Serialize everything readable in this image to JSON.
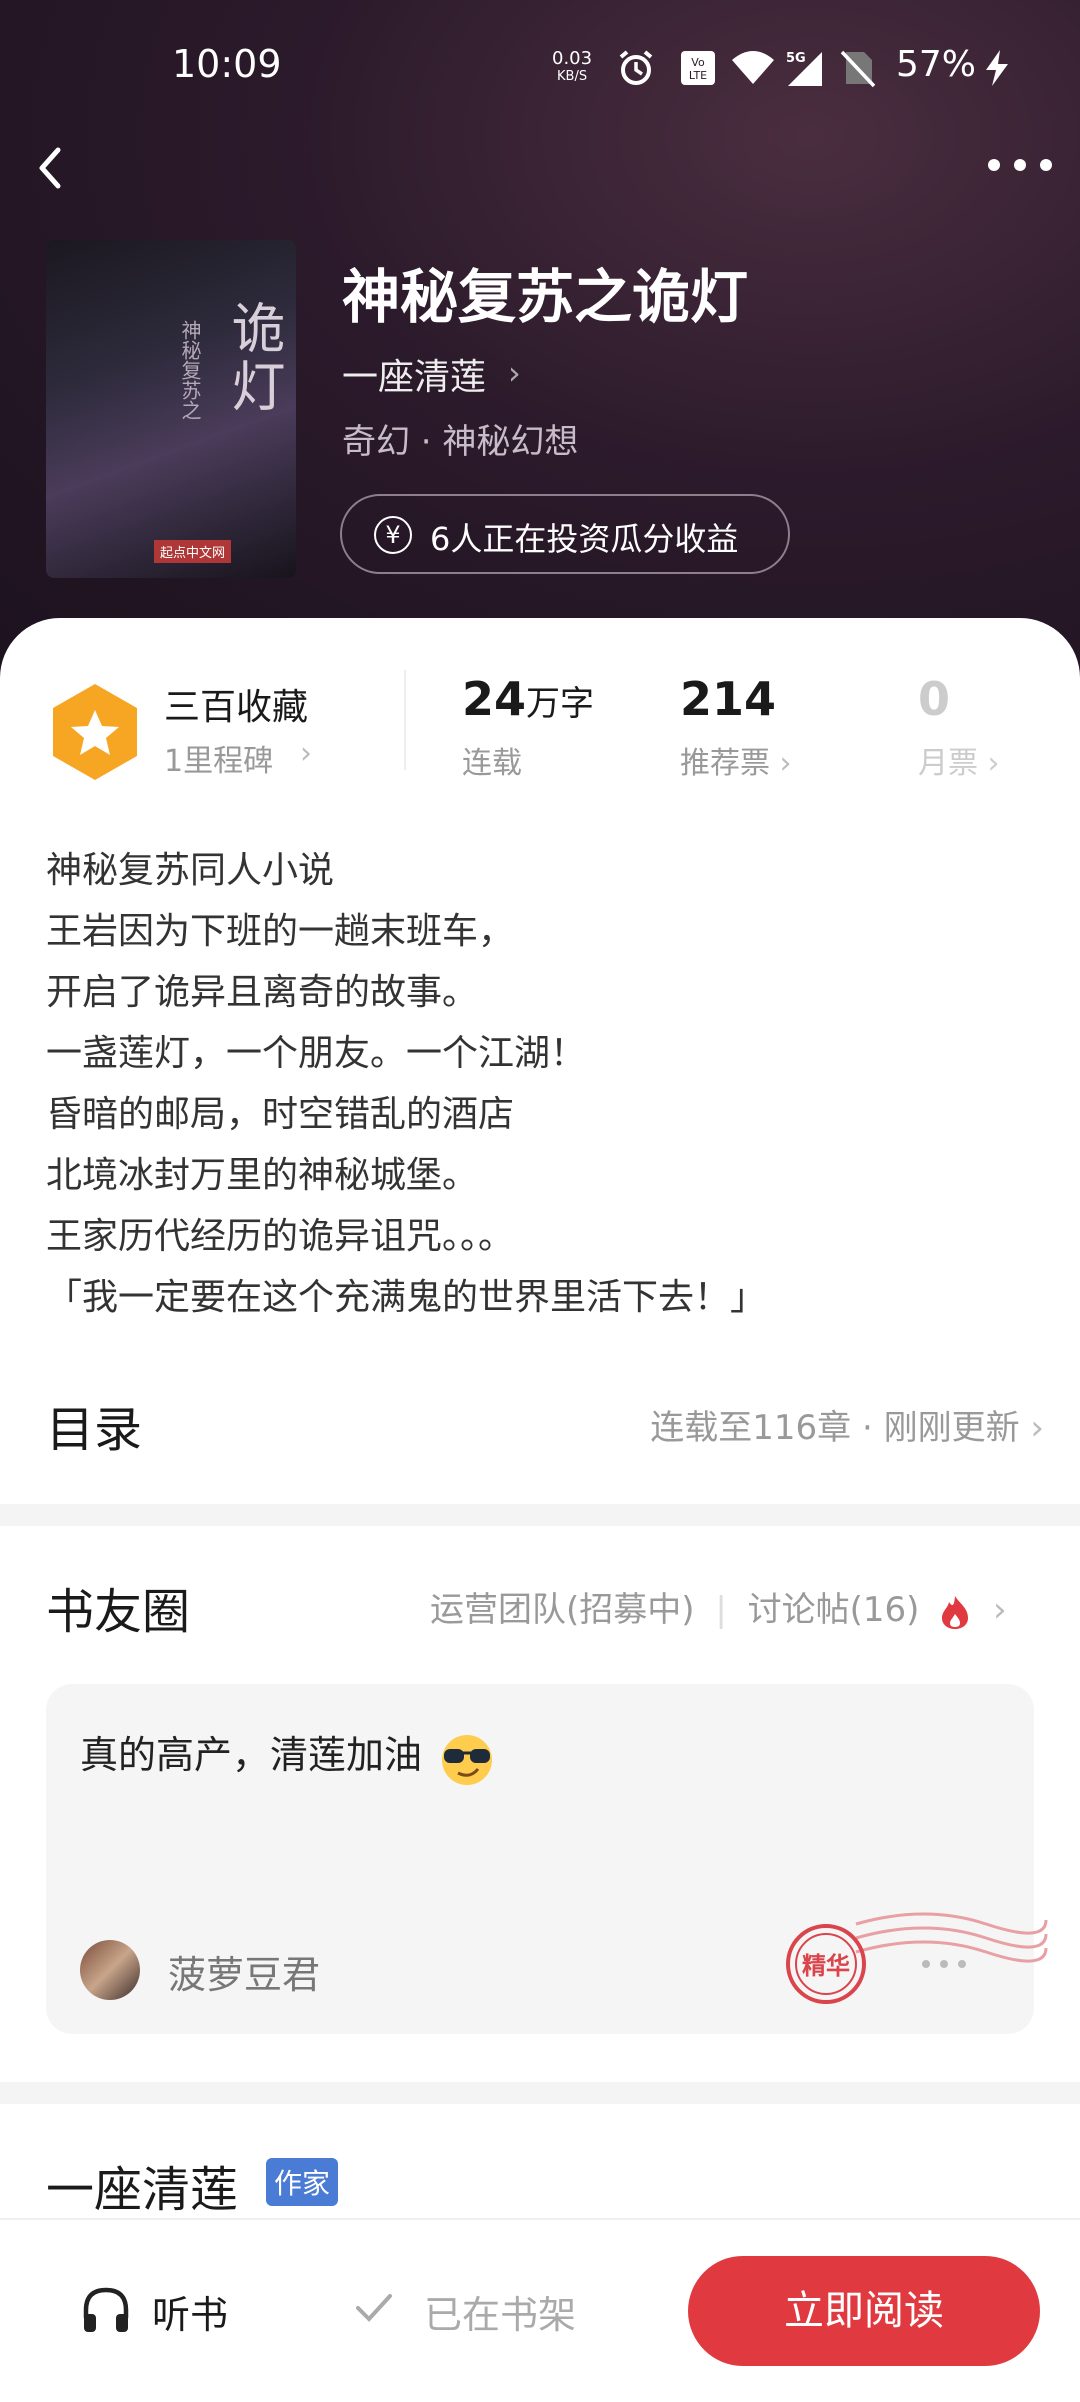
{
  "status_bar": {
    "time": "10:09",
    "net_speed_value": "0.03",
    "net_speed_unit": "KB/S",
    "battery": "57%",
    "icons": [
      "alarm-icon",
      "volte-icon",
      "wifi-icon",
      "5g-signal-icon",
      "no-sim-icon",
      "charging-icon"
    ]
  },
  "nav": {
    "back_icon": "back-arrow-icon",
    "more_icon": "more-dots-icon"
  },
  "book": {
    "cover_title": "诡灯",
    "cover_subtitle": "神秘复苏之",
    "cover_brand": "起点中文网",
    "title": "神秘复苏之诡灯",
    "author": "一座清莲",
    "genre": "奇幻 · 神秘幻想",
    "invest_text": "6人正在投资瓜分收益"
  },
  "stats": {
    "level_title": "三百收藏",
    "level_sub": "1里程碑",
    "words_value": "24",
    "words_unit": "万字",
    "words_label": "连载",
    "recommend_value": "214",
    "recommend_label": "推荐票",
    "monthly_value": "0",
    "monthly_label": "月票"
  },
  "description": [
    "神秘复苏同人小说",
    "王岩因为下班的一趟末班车，",
    "开启了诡异且离奇的故事。",
    "一盏莲灯，一个朋友。一个江湖！",
    "昏暗的邮局，时空错乱的酒店",
    "北境冰封万里的神秘城堡。",
    "王家历代经历的诡异诅咒。。。",
    "「我一定要在这个充满鬼的世界里活下去！」"
  ],
  "toc": {
    "title": "目录",
    "meta": "连载至116章 · 刚刚更新"
  },
  "circle": {
    "title": "书友圈",
    "team": "运营团队(招募中)",
    "discussion": "讨论帖(16)",
    "post_text": "真的高产，清莲加油",
    "post_user": "菠萝豆君",
    "stamp_text": "精华"
  },
  "author_section": {
    "name": "一座清莲",
    "tag": "作家"
  },
  "bottom_bar": {
    "listen_label": "听书",
    "shelf_label": "已在书架",
    "read_label": "立即阅读"
  },
  "colors": {
    "accent": "#e03a40",
    "author_tag": "#4a7bd5",
    "badge": "#f7a623"
  }
}
